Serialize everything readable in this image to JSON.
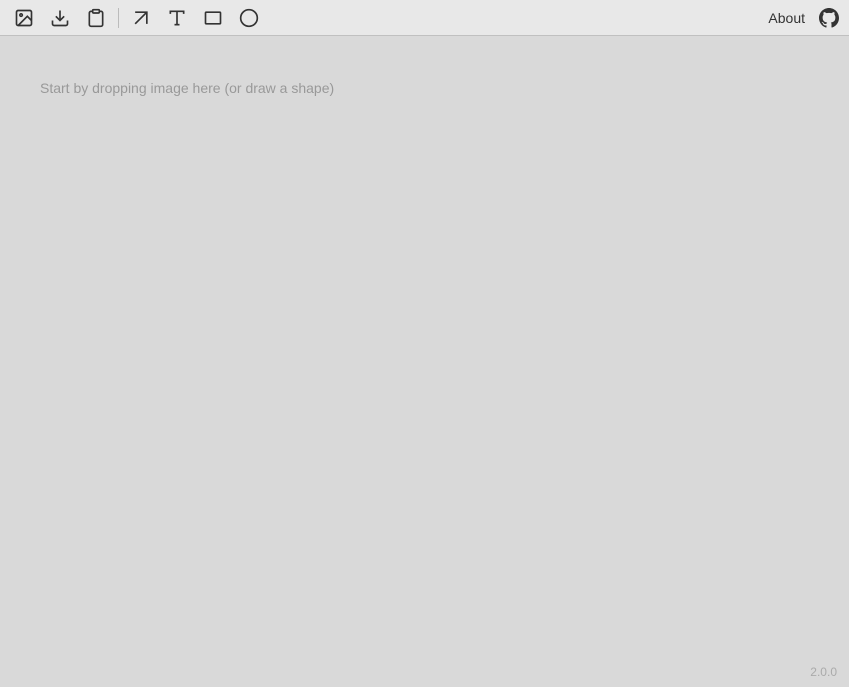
{
  "toolbar": {
    "tools": [
      {
        "name": "image-tool",
        "label": "Image"
      },
      {
        "name": "download-tool",
        "label": "Download"
      },
      {
        "name": "clipboard-tool",
        "label": "Clipboard"
      },
      {
        "name": "arrow-tool",
        "label": "Arrow"
      },
      {
        "name": "text-tool",
        "label": "Text"
      },
      {
        "name": "rectangle-tool",
        "label": "Rectangle"
      },
      {
        "name": "ellipse-tool",
        "label": "Ellipse"
      }
    ],
    "about_label": "About",
    "github_label": "GitHub"
  },
  "canvas": {
    "hint_text": "Start by dropping image here (or draw a shape)"
  },
  "footer": {
    "version": "2.0.0"
  },
  "colors": {
    "toolbar_bg": "#e8e8e8",
    "canvas_bg": "#d9d9d9",
    "hint_color": "#999999",
    "version_color": "#aaaaaa"
  }
}
